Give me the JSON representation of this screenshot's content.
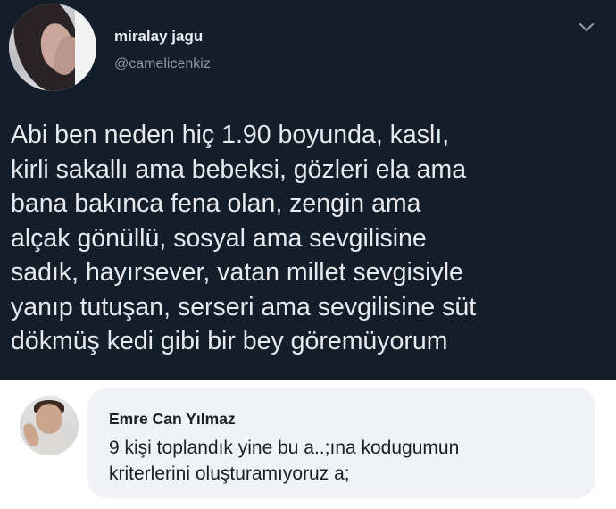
{
  "tweet": {
    "display_name": "miralay jagu",
    "handle": "@camelicenkiz",
    "text": "Abi ben neden hiç 1.90 boyunda, kaslı,\nkirli sakallı ama bebeksi, gözleri ela ama\nbana bakınca fena olan, zengin ama\nalçak gönüllü, sosyal ama sevgilisine\nsadık, hayırsever, vatan millet sevgisiyle\nyanıp tutuşan, serseri ama sevgilisine süt\ndökmüş kedi gibi bir bey göremüyorum",
    "menu_icon": "chevron-down-icon"
  },
  "comment": {
    "author": "Emre Can Yılmaz",
    "text": "9 kişi toplandık yine bu a..;ına kodugumun\nkriterlerini oluşturamıyoruz a;"
  },
  "colors": {
    "tweet_background": "#141d2a",
    "tweet_text": "#e6e9ee",
    "handle_text": "#8a96a6",
    "comment_bubble": "#f0f2f5",
    "comment_text": "#1c1e21"
  }
}
